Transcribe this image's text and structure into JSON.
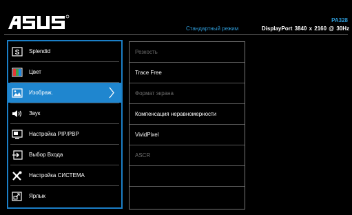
{
  "header": {
    "logo_text": "ASUS",
    "model": "PA328",
    "mode": "Стандартный режим",
    "input_info": "DisplayPort 3840 x 2160 @ 30Hz"
  },
  "menu": {
    "items": [
      {
        "label": "Splendid",
        "icon": "splendid-s-icon"
      },
      {
        "label": "Цвет",
        "icon": "color-bars-icon"
      },
      {
        "label": "Изображ.",
        "icon": "image-icon",
        "active": true
      },
      {
        "label": "Звук",
        "icon": "speaker-icon"
      },
      {
        "label": "Настройка PIP/PBP",
        "icon": "pip-pbp-icon"
      },
      {
        "label": "Выбор Входа",
        "icon": "input-select-icon"
      },
      {
        "label": "Настройка СИСТЕМА",
        "icon": "tools-icon"
      },
      {
        "label": "Ярлык",
        "icon": "shortcut-icon"
      }
    ]
  },
  "submenu": {
    "items": [
      {
        "label": "Резкость",
        "enabled": false
      },
      {
        "label": "Trace Free",
        "enabled": true
      },
      {
        "label": "Формат экрана",
        "enabled": false
      },
      {
        "label": "Компенсация неравномерности",
        "enabled": true
      },
      {
        "label": "VividPixel",
        "enabled": true
      },
      {
        "label": "ASCR",
        "enabled": false
      },
      {
        "label": "",
        "enabled": false
      },
      {
        "label": "",
        "enabled": false
      }
    ]
  },
  "colors": {
    "accent": "#1f86cf",
    "header_text": "#2e9ad6",
    "disabled_text": "#6e6e6e"
  }
}
